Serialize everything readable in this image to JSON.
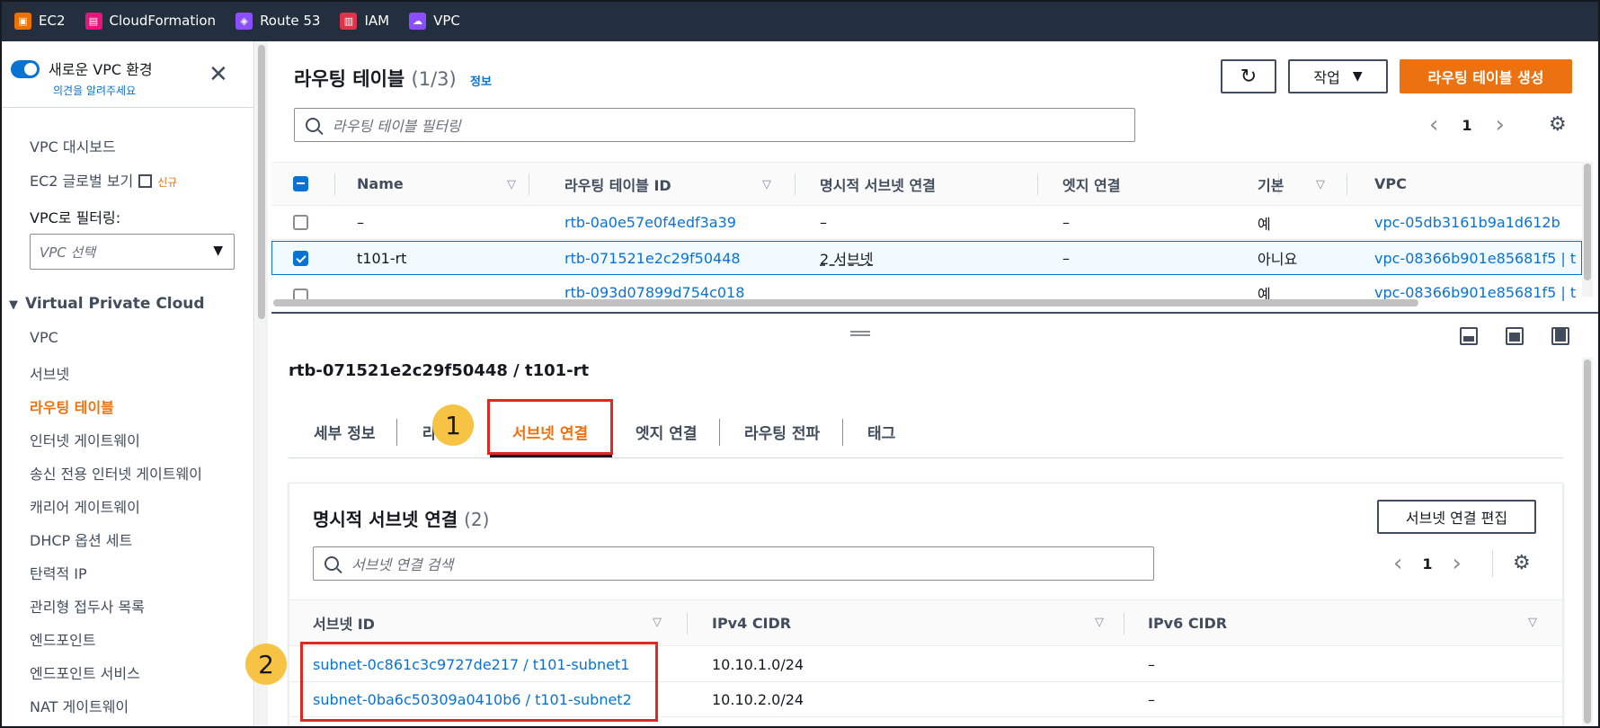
{
  "services": [
    {
      "label": "EC2",
      "color": "#ed7100",
      "icon": "ec2-icon"
    },
    {
      "label": "CloudFormation",
      "color": "#e7157b",
      "icon": "cloudformation-icon"
    },
    {
      "label": "Route 53",
      "color": "#8c4fff",
      "icon": "route53-icon"
    },
    {
      "label": "IAM",
      "color": "#dd344c",
      "icon": "iam-icon"
    },
    {
      "label": "VPC",
      "color": "#8c4fff",
      "icon": "vpc-icon"
    }
  ],
  "sidebar": {
    "toggle_title": "새로운 VPC 환경",
    "toggle_sub": "의견을 알려주세요",
    "dashboard": "VPC 대시보드",
    "global_view": "EC2 글로벌 보기",
    "new_badge": "신규",
    "filter_label": "VPC로 필터링:",
    "filter_placeholder": "VPC 선택",
    "section": "Virtual Private Cloud",
    "items": [
      "VPC",
      "서브넷",
      "라우팅 테이블",
      "인터넷 게이트웨이",
      "송신 전용 인터넷 게이트웨이",
      "캐리어 게이트웨이",
      "DHCP 옵션 세트",
      "탄력적 IP",
      "관리형 접두사 목록",
      "엔드포인트",
      "엔드포인트 서비스",
      "NAT 게이트웨이"
    ],
    "active_item": "라우팅 테이블"
  },
  "main": {
    "title": "라우팅 테이블",
    "count": "(1/3)",
    "info": "정보",
    "actions_label": "작업",
    "create_label": "라우팅 테이블 생성",
    "search_placeholder": "라우팅 테이블 필터링",
    "page": "1",
    "columns": [
      "Name",
      "라우팅 테이블 ID",
      "명시적 서브넷 연결",
      "엣지 연결",
      "기본",
      "VPC"
    ],
    "rows": [
      {
        "name": "–",
        "id": "rtb-0a0e57e0f4edf3a39",
        "subnets": "–",
        "edge": "–",
        "main": "예",
        "vpc": "vpc-05db3161b9a1d612b",
        "selected": false
      },
      {
        "name": "t101-rt",
        "id": "rtb-071521e2c29f50448",
        "subnets": "2 서브넷",
        "edge": "–",
        "main": "아니요",
        "vpc": "vpc-08366b901e85681f5 | t",
        "selected": true
      },
      {
        "name": "",
        "id": "rtb-093d07899d754c018",
        "subnets": "",
        "edge": "",
        "main": "예",
        "vpc": "vpc-08366b901e85681f5 | t",
        "selected": false
      }
    ]
  },
  "detail": {
    "title": "rtb-071521e2c29f50448 / t101-rt",
    "tabs": [
      "세부 정보",
      "라",
      "서브넷 연결",
      "엣지 연결",
      "라우팅 전파",
      "태그"
    ],
    "active_tab": "서브넷 연결",
    "badge1": "1",
    "badge2": "2",
    "inner_title": "명시적 서브넷 연결",
    "inner_count": "(2)",
    "edit_label": "서브넷 연결 편집",
    "search_placeholder": "서브넷 연결 검색",
    "page": "1",
    "columns": [
      "서브넷 ID",
      "IPv4 CIDR",
      "IPv6 CIDR"
    ],
    "rows": [
      {
        "subnet": "subnet-0c861c3c9727de217 / t101-subnet1",
        "ipv4": "10.10.1.0/24",
        "ipv6": "–"
      },
      {
        "subnet": "subnet-0ba6c50309a0410b6 / t101-subnet2",
        "ipv4": "10.10.2.0/24",
        "ipv6": "–"
      }
    ]
  }
}
